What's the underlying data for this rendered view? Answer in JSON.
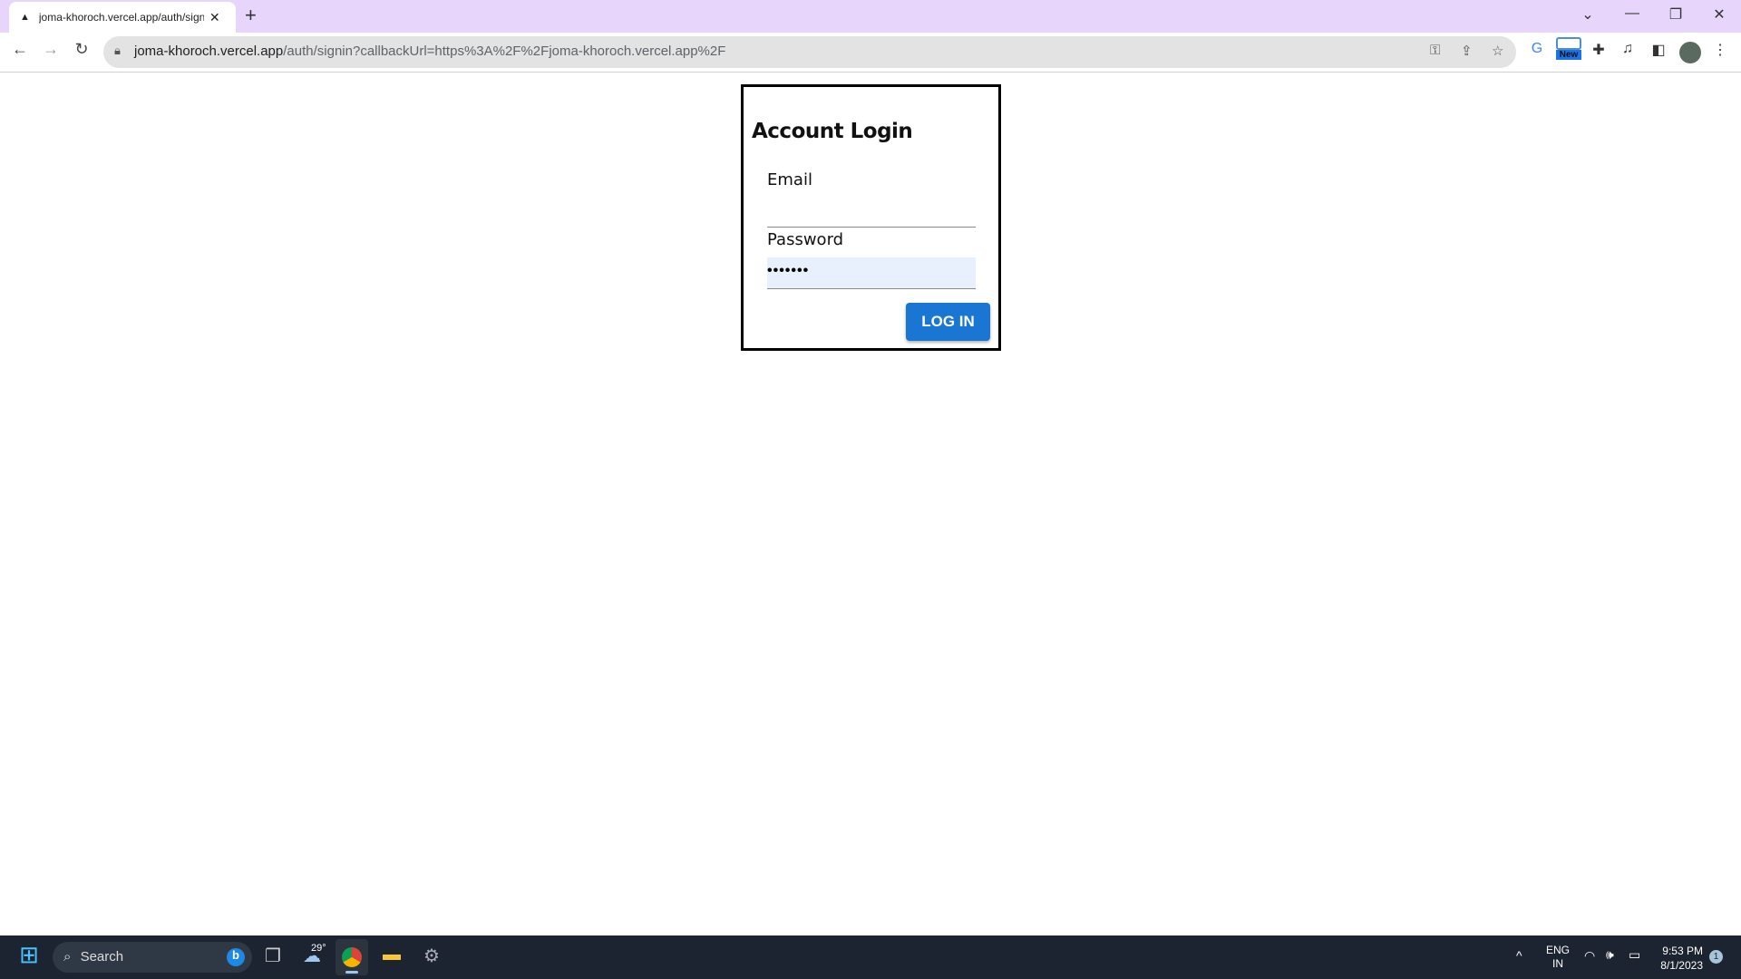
{
  "browser": {
    "tab_title": "joma-khoroch.vercel.app/auth/signin",
    "tab_favicon": "vercel-triangle-icon",
    "url_host": "joma-khoroch.vercel.app",
    "url_path": "/auth/signin?callbackUrl=https%3A%2F%2Fjoma-khoroch.vercel.app%2F",
    "extension_badge": "New"
  },
  "login": {
    "title": "Account Login",
    "email_label": "Email",
    "email_value": "",
    "password_label": "Password",
    "password_value": "•••••••",
    "button_label": "LOG IN",
    "accent_color": "#1976d2"
  },
  "taskbar": {
    "search_placeholder": "Search",
    "weather_temp": "29°",
    "language": "ENG",
    "region": "IN",
    "time": "9:53 PM",
    "date": "8/1/2023",
    "notification_count": "1"
  }
}
